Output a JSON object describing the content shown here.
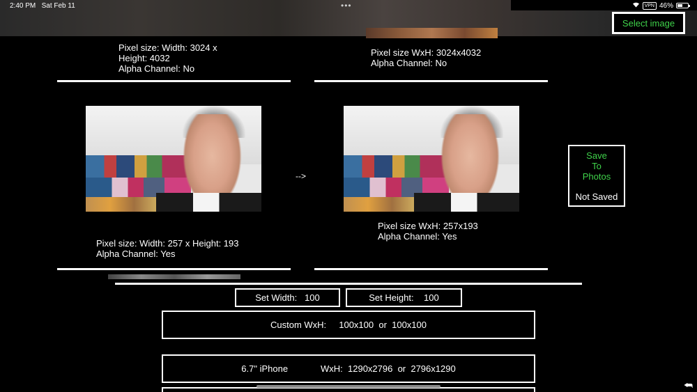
{
  "status_bar": {
    "time": "2:40 PM",
    "date": "Sat Feb 11",
    "vpn": "VPN",
    "battery": "46%"
  },
  "toolbar": {
    "select_image": "Select image"
  },
  "original_top": {
    "line1": "Pixel size: Width: 3024 x",
    "line2": "Height: 4032",
    "line3": " Alpha Channel: No"
  },
  "converted_top": {
    "line1": "Pixel size WxH: 3024x4032",
    "line2": "Alpha Channel: No"
  },
  "original_bottom": {
    "line1": "Pixel size: Width: 257 x Height: 193",
    "line2": " Alpha Channel: Yes"
  },
  "converted_bottom": {
    "line1": "Pixel size WxH: 257x193",
    "line2": "Alpha Channel: Yes"
  },
  "arrow": "-->",
  "save": {
    "line1": "Save",
    "line2": "To",
    "line3": "Photos",
    "status": "Not Saved"
  },
  "controls": {
    "set_width": "Set Width:   100",
    "set_height": "Set Height:    100",
    "custom": "Custom WxH:     100x100  or  100x100",
    "iphone": "6.7\" iPhone             WxH:  1290x2796  or  2796x1290"
  },
  "colors": {
    "accent_green": "#3fd24a",
    "background": "#000000",
    "border": "#ffffff"
  }
}
